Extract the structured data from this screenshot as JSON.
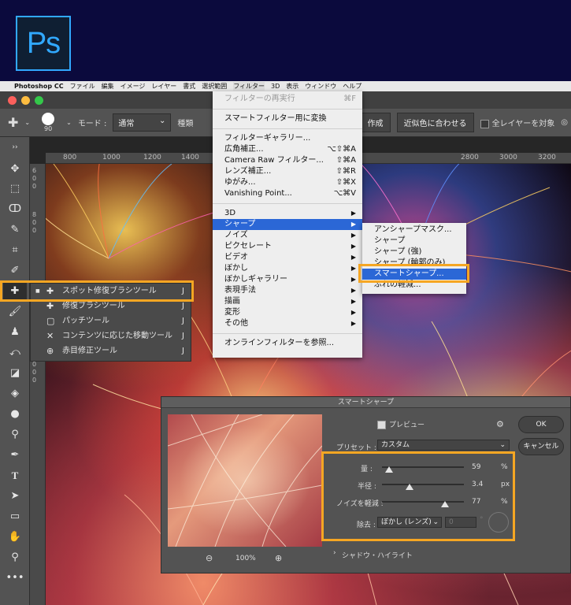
{
  "logo": {
    "text": "Ps"
  },
  "menubar": {
    "apple": "",
    "app": "Photoshop CC",
    "items": [
      "ファイル",
      "編集",
      "イメージ",
      "レイヤー",
      "書式",
      "選択範囲",
      "フィルター",
      "3D",
      "表示",
      "ウィンドウ",
      "ヘルプ"
    ]
  },
  "colors": {
    "accent_orange": "#f5a623",
    "highlight_blue": "#2b67d6",
    "ps_blue": "#31a8ff"
  },
  "options": {
    "brush_size": "90",
    "mode_label": "モード :",
    "mode_value": "通常",
    "type_label": "種類",
    "create_btn": "作成",
    "match_btn": "近似色に合わせる",
    "all_layers": "全レイヤーを対象"
  },
  "ruler": {
    "top": [
      "800",
      "1000",
      "1200",
      "1400",
      "2800",
      "3000",
      "3200"
    ],
    "left": [
      "6",
      "0",
      "0",
      "8",
      "0",
      "0",
      "1",
      "0",
      "0",
      "0"
    ]
  },
  "filter_menu": {
    "items": [
      {
        "label": "フィルターの再実行",
        "shortcut": "⌘F",
        "disabled": true
      },
      {
        "sep": true
      },
      {
        "label": "スマートフィルター用に変換"
      },
      {
        "sep": true
      },
      {
        "label": "フィルターギャラリー..."
      },
      {
        "label": "広角補正...",
        "shortcut": "⌥⇧⌘A"
      },
      {
        "label": "Camera Raw フィルター...",
        "shortcut": "⇧⌘A"
      },
      {
        "label": "レンズ補正...",
        "shortcut": "⇧⌘R"
      },
      {
        "label": "ゆがみ...",
        "shortcut": "⇧⌘X"
      },
      {
        "label": "Vanishing Point...",
        "shortcut": "⌥⌘V"
      },
      {
        "sep": true
      },
      {
        "label": "3D",
        "sub": true
      },
      {
        "label": "シャープ",
        "sub": true,
        "hl": true
      },
      {
        "label": "ノイズ",
        "sub": true
      },
      {
        "label": "ピクセレート",
        "sub": true
      },
      {
        "label": "ビデオ",
        "sub": true
      },
      {
        "label": "ぼかし",
        "sub": true
      },
      {
        "label": "ぼかしギャラリー",
        "sub": true
      },
      {
        "label": "表現手法",
        "sub": true
      },
      {
        "label": "描画",
        "sub": true
      },
      {
        "label": "変形",
        "sub": true
      },
      {
        "label": "その他",
        "sub": true
      },
      {
        "sep": true
      },
      {
        "label": "オンラインフィルターを参照..."
      }
    ]
  },
  "sharpen_submenu": {
    "items": [
      {
        "label": "アンシャープマスク..."
      },
      {
        "label": "シャープ"
      },
      {
        "label": "シャープ (強)"
      },
      {
        "label": "シャープ (輪郭のみ)"
      },
      {
        "label": "スマートシャープ...",
        "hl": true
      },
      {
        "label": "ぶれの軽減..."
      }
    ]
  },
  "tool_flyout": {
    "items": [
      {
        "icon": "■",
        "label": "スポット修復ブラシツール",
        "key": "J"
      },
      {
        "icon": "",
        "label": "修復ブラシツール",
        "key": "J"
      },
      {
        "icon": "",
        "label": "パッチツール",
        "key": "J"
      },
      {
        "icon": "",
        "label": "コンテンツに応じた移動ツール",
        "key": "J"
      },
      {
        "icon": "",
        "label": "赤目修正ツール",
        "key": "J"
      }
    ]
  },
  "dialog": {
    "title": "スマートシャープ",
    "preview_label": "プレビュー",
    "ok": "OK",
    "cancel": "キャンセル",
    "preset_label": "プリセット :",
    "preset_value": "カスタム",
    "zoom": "100%",
    "amount": {
      "label": "量 :",
      "value": "59",
      "unit": "%",
      "level": 0.09
    },
    "radius": {
      "label": "半径 :",
      "value": "3.4",
      "unit": "px",
      "level": 0.34
    },
    "noise": {
      "label": "ノイズを軽減 :",
      "value": "77",
      "unit": "%",
      "level": 0.77
    },
    "remove": {
      "label": "除去 :",
      "value": "ぼかし (レンズ)",
      "angle": "0",
      "angle_unit": "°"
    },
    "shadow_highlight": "シャドウ・ハイライト"
  }
}
